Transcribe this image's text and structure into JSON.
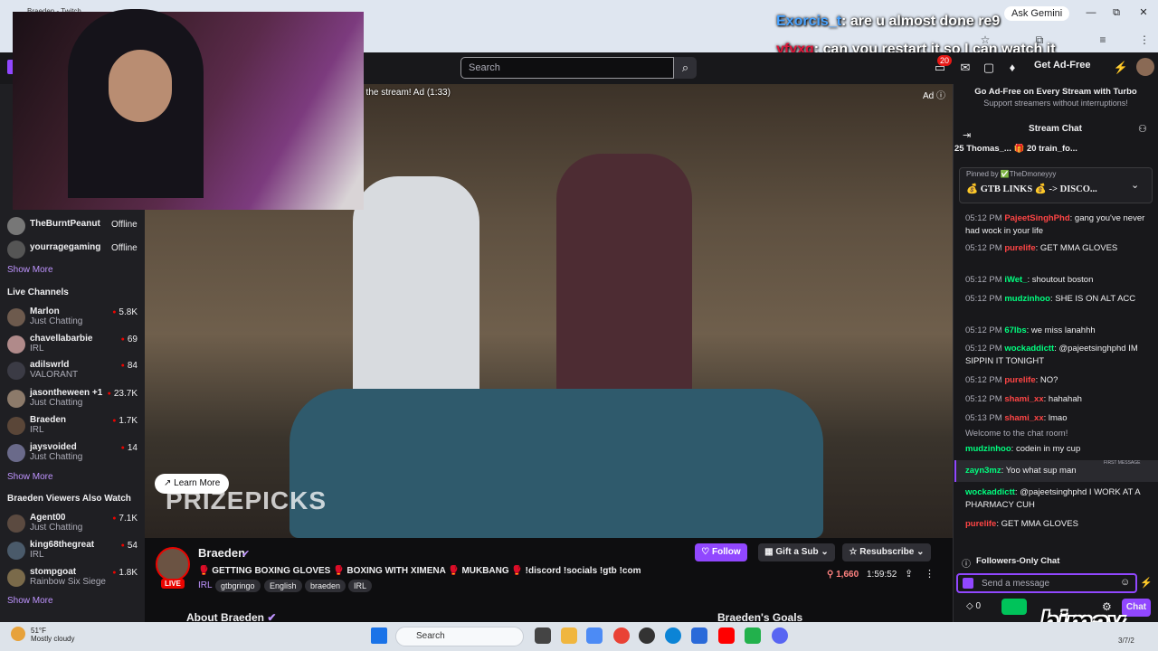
{
  "browser": {
    "tab_title": "Braeden - Twitch",
    "ask_gemini": "Ask Gemini",
    "window_min": "—",
    "window_max": "⧉",
    "window_close": "✕"
  },
  "overlay_chat": [
    {
      "user": "Exorcis_t",
      "text": "are u almost done re9"
    },
    {
      "user": "yfvxq",
      "text": "can you restart it so I can watch it"
    }
  ],
  "twitch_nav": {
    "search_placeholder": "Search",
    "notifications": "20",
    "get_ad_free": "Get Ad-Free"
  },
  "sidebar": {
    "followed_offline": [
      {
        "name": "TheBurntPeanut",
        "status": "Offline"
      },
      {
        "name": "yourragegaming",
        "status": "Offline"
      }
    ],
    "show_more_1": "Show More",
    "live_heading": "Live Channels",
    "live_channels": [
      {
        "name": "Marlon",
        "category": "Just Chatting",
        "viewers": "5.8K"
      },
      {
        "name": "chavellabarbie",
        "category": "IRL",
        "viewers": "69"
      },
      {
        "name": "adilswrld",
        "category": "VALORANT",
        "viewers": "84"
      },
      {
        "name": "jasontheween +1",
        "category": "Just Chatting",
        "viewers": "23.7K"
      },
      {
        "name": "Braeden",
        "category": "IRL",
        "viewers": "1.7K"
      },
      {
        "name": "jaysvoided",
        "category": "Just Chatting",
        "viewers": "14"
      }
    ],
    "show_more_2": "Show More",
    "also_watch_heading": "Braeden Viewers Also Watch",
    "also_watch": [
      {
        "name": "Agent00",
        "category": "Just Chatting",
        "viewers": "7.1K"
      },
      {
        "name": "king68thegreat",
        "category": "IRL",
        "viewers": "54"
      },
      {
        "name": "stompgoat",
        "category": "Rainbow Six Siege",
        "viewers": "1.8K"
      }
    ],
    "show_more_3": "Show More"
  },
  "video": {
    "ad_text": "t the stream! Ad (1:33)",
    "ad_badge": "Ad ⓘ",
    "learn_more": "Learn More",
    "sponsor": "PRIZEPICKS"
  },
  "channel": {
    "name": "Braeden",
    "live": "LIVE",
    "title": "🥊 GETTING BOXING GLOVES 🥊 BOXING WITH XIMENA 🥊 MUKBANG 🥊 !discord !socials !gtb !com",
    "category": "IRL",
    "tags": [
      "gtbgringo",
      "English",
      "braeden",
      "IRL"
    ],
    "follow": "Follow",
    "gift_sub": "Gift a Sub",
    "resubscribe": "Resubscribe",
    "viewers": "1,660",
    "uptime": "1:59:52",
    "about": "About Braeden",
    "goals": "Braeden's Goals"
  },
  "chat": {
    "promo_title": "Go Ad-Free on Every Stream with Turbo",
    "promo_sub": "Support streamers without interruptions!",
    "title": "Stream Chat",
    "gifters": "25   Thomas_...  🎁 20   train_fo...",
    "pinned_by": "Pinned by ✅TheDmoneyyy",
    "pinned_msg": "💰 GTB LINKS 💰 -> DISCO...",
    "messages": [
      {
        "time": "05:12 PM",
        "user": "PajeetSinghPhd",
        "color": "#ff4545",
        "text": "gang you've never had wock in your life"
      },
      {
        "time": "05:12 PM",
        "user": "purelife",
        "color": "#ff4545",
        "text": "GET MMA GLOVES"
      },
      {
        "time": "05:12 PM",
        "user": "iWet_",
        "color": "#00ff7f",
        "text": "shoutout boston"
      },
      {
        "time": "05:12 PM",
        "user": "mudzinhoo",
        "color": "#00ff7f",
        "text": "SHE IS ON ALT ACC"
      },
      {
        "time": "05:12 PM",
        "user": "67lbs",
        "color": "#00ff7f",
        "text": "we miss lanahhh"
      },
      {
        "time": "05:12 PM",
        "user": "wockaddictt",
        "color": "#00ff7f",
        "text": "@pajeetsinghphd IM SIPPIN IT TONIGHT"
      },
      {
        "time": "05:12 PM",
        "user": "purelife",
        "color": "#ff4545",
        "text": "NO?"
      },
      {
        "time": "05:12 PM",
        "user": "shami_xx",
        "color": "#ff4545",
        "text": "hahahah"
      },
      {
        "time": "05:13 PM",
        "user": "shami_xx",
        "color": "#ff4545",
        "text": "lmao"
      }
    ],
    "welcome": "Welcome to the chat room!",
    "msg_codein_user": "mudzinhoo",
    "msg_codein_text": "codein in my cup",
    "first_label": "FIRST MESSAGE",
    "msg_first_user": "zayn3mz",
    "msg_first_text": "Yoo what sup man",
    "msg_wock_user": "wockaddictt",
    "msg_wock_text": "@pajeetsinghphd I WORK AT A PHARMACY CUH",
    "msg_pure_user": "purelife",
    "msg_pure_text": "GET MMA GLOVES",
    "followers_only": "Followers-Only Chat",
    "send_placeholder": "Send a message",
    "points": "0",
    "chat_button": "Chat",
    "watermark": "himay"
  },
  "taskbar": {
    "weather_temp": "51°F",
    "weather_desc": "Mostly cloudy",
    "search": "Search",
    "date": "3/7/2"
  }
}
